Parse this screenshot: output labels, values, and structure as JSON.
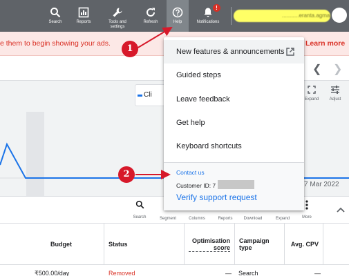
{
  "toolbar": {
    "items": [
      {
        "label": "Search",
        "icon": "search-icon"
      },
      {
        "label": "Reports",
        "icon": "reports-icon"
      },
      {
        "label": "Tools and settings",
        "icon": "wrench-icon"
      },
      {
        "label": "Refresh",
        "icon": "refresh-icon"
      },
      {
        "label": "Help",
        "icon": "help-icon"
      },
      {
        "label": "Notifications",
        "icon": "bell-icon"
      }
    ],
    "notification_badge": "!",
    "account_email": "...........eranta.agmai..."
  },
  "alert": {
    "text": "e them to begin showing your ads.",
    "link": "Learn more"
  },
  "chart": {
    "chip_label": "Cli",
    "tools": [
      {
        "label": "Expand",
        "icon": "expand-icon"
      },
      {
        "label": "Adjust",
        "icon": "adjust-icon"
      }
    ],
    "end_date": "7 Mar 2022",
    "series_color": "#1a73e8"
  },
  "table_toolbar": {
    "items": [
      {
        "label": "Search",
        "icon": "search-icon"
      },
      {
        "label": "Segment",
        "icon": "segment-icon"
      },
      {
        "label": "Columns",
        "icon": "columns-icon"
      },
      {
        "label": "Reports",
        "icon": "reports-icon"
      },
      {
        "label": "Download",
        "icon": "download-icon"
      },
      {
        "label": "Expand",
        "icon": "expand-icon"
      },
      {
        "label": "More",
        "icon": "more-icon"
      }
    ]
  },
  "table": {
    "headers": [
      "Budget",
      "Status",
      "Optimisation score",
      "Campaign type",
      "Avg. CPV"
    ],
    "row": {
      "budget": "₹500.00/day",
      "status": "Removed",
      "score": "—",
      "type": "Search",
      "cpv": "—"
    }
  },
  "help_menu": {
    "items": [
      "New features & announcements",
      "Guided steps",
      "Leave feedback",
      "Get help",
      "Keyboard shortcuts"
    ],
    "contact_us": "Contact us",
    "customer_id_label": "Customer ID: 7",
    "verify": "Verify support request"
  },
  "annotations": {
    "marker1": "1",
    "marker2": "2"
  },
  "colors": {
    "toolbar_bg": "#5f6368",
    "alert_text": "#d93025",
    "link_blue": "#1a73e8",
    "annotation_red": "#d7192a"
  }
}
